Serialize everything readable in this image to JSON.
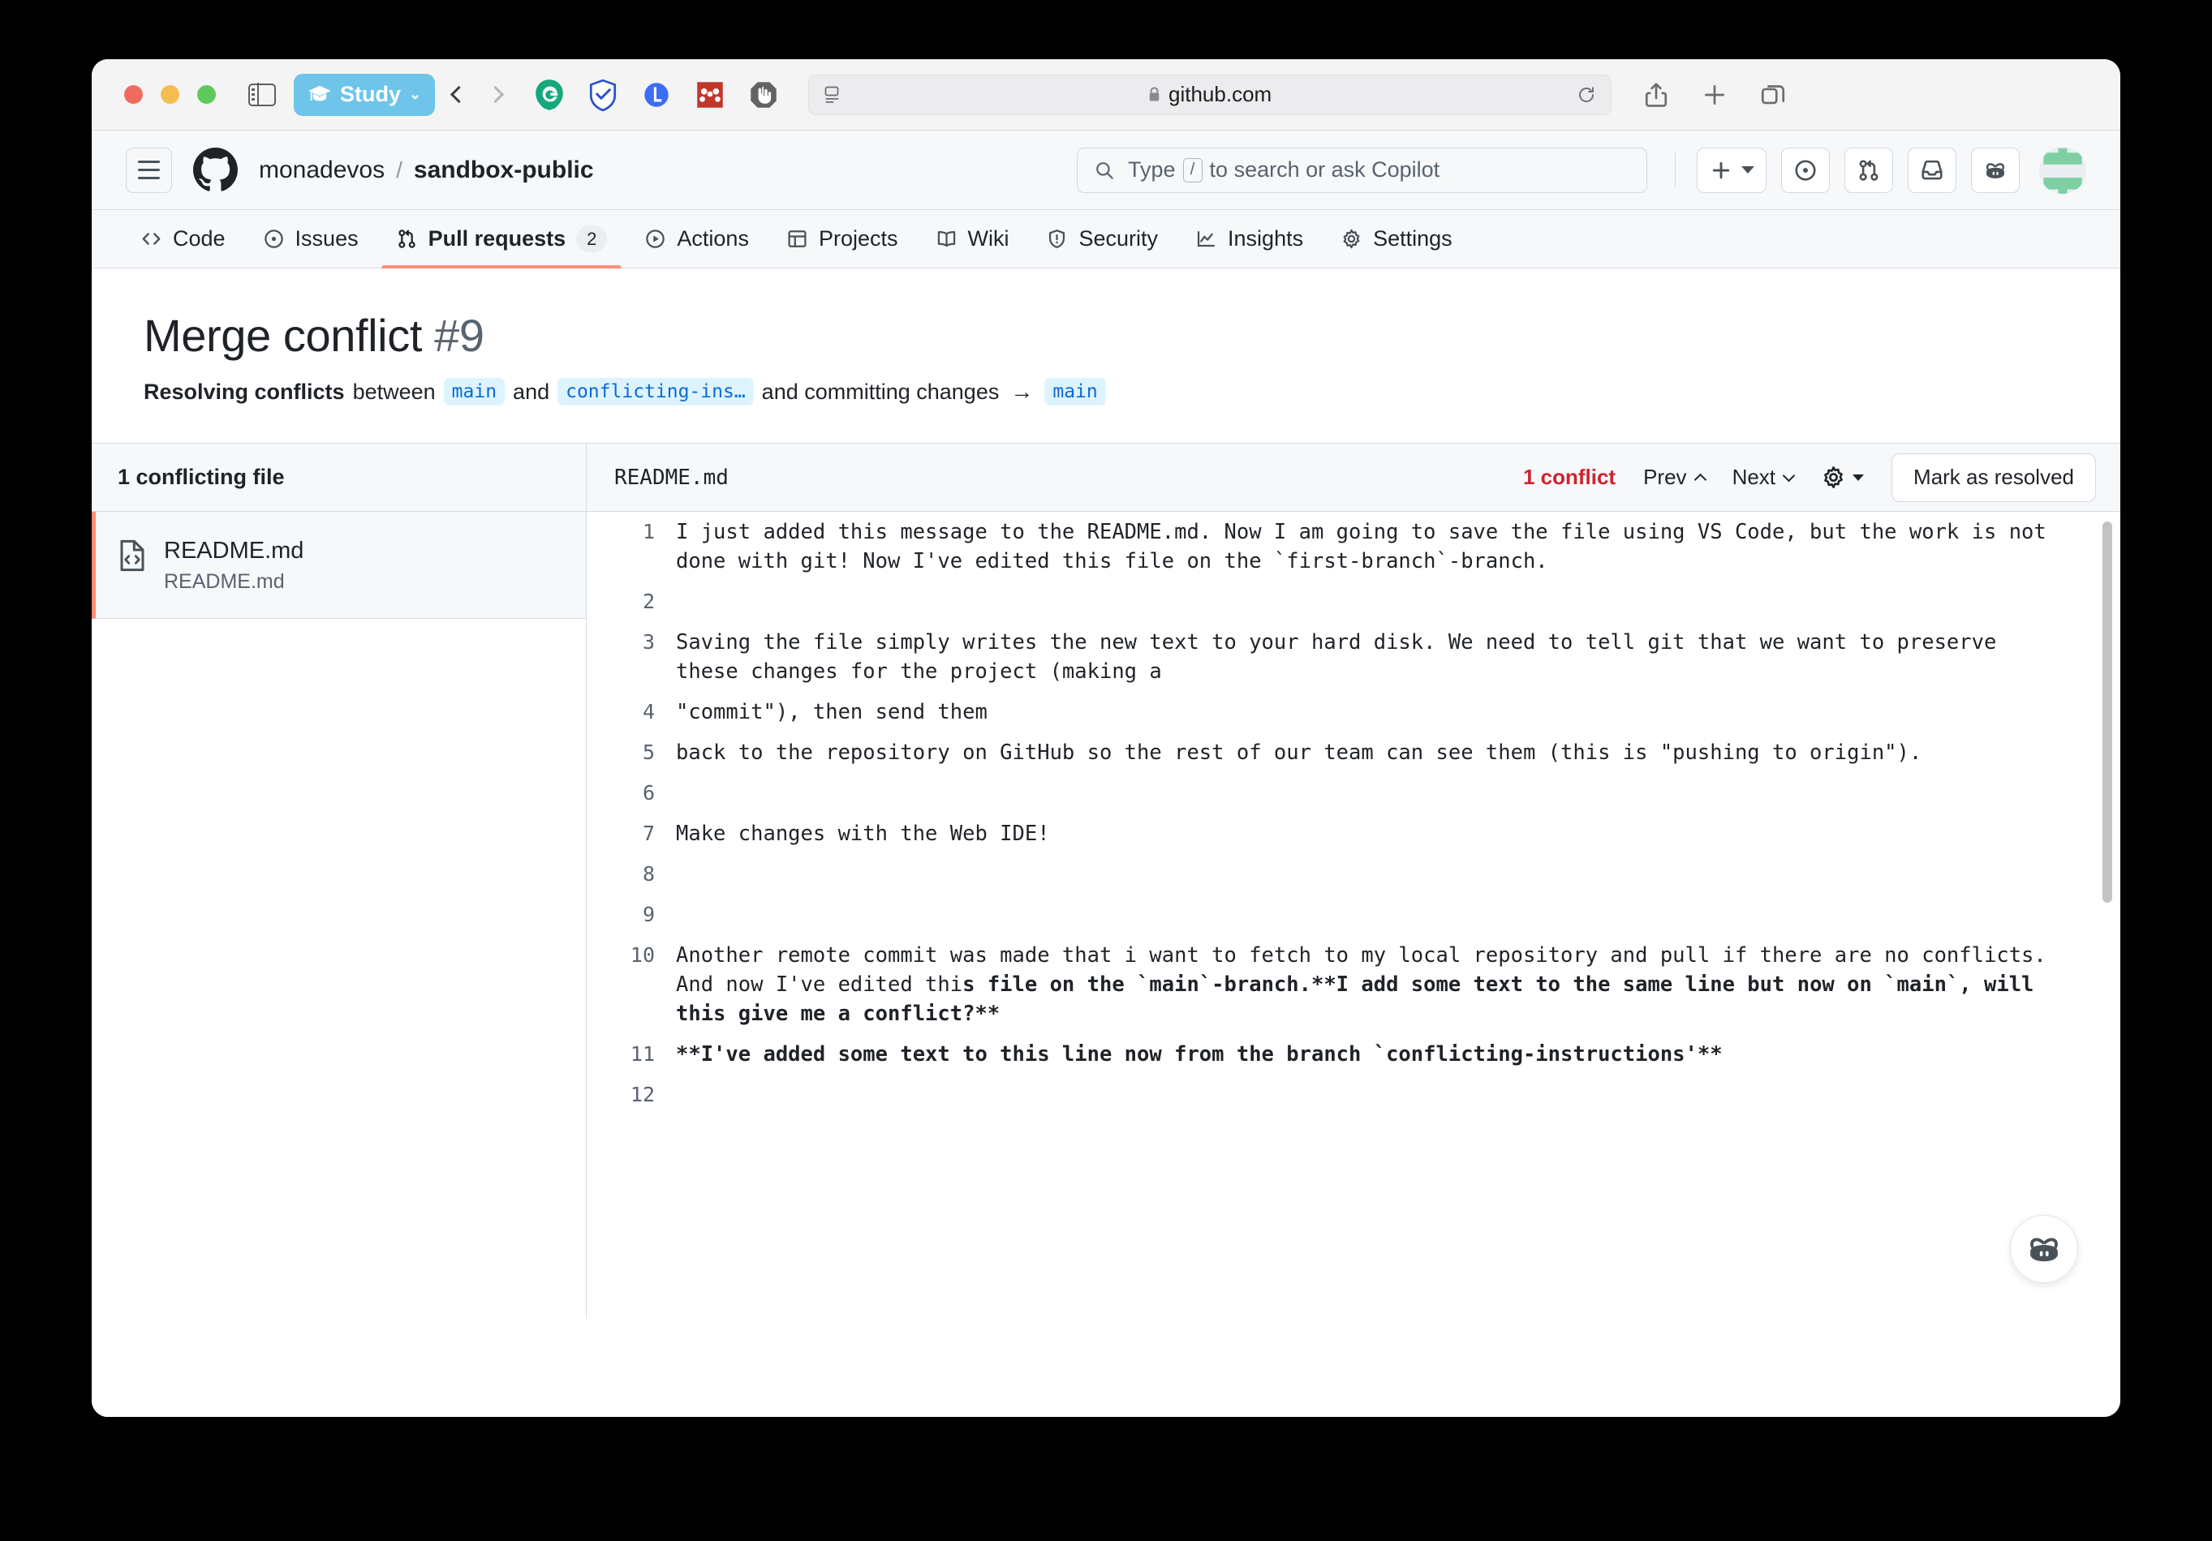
{
  "browser": {
    "profile_label": "Study",
    "address": "github.com",
    "extensions": [
      "grammarly-icon",
      "adguard-icon",
      "lastpass-icon",
      "mendeley-icon",
      "adblock-icon"
    ],
    "toolbar_icons": [
      "sidebar-toggle-icon",
      "back-icon",
      "forward-icon",
      "reader-icon",
      "lock-icon",
      "reload-icon",
      "share-icon",
      "new-tab-icon",
      "tab-overview-icon"
    ]
  },
  "header": {
    "owner": "monadevos",
    "separator": "/",
    "repo": "sandbox-public",
    "search_placeholder": "Type",
    "search_key": "/",
    "search_placeholder_tail": "to search or ask Copilot"
  },
  "tabs": [
    {
      "label": "Code",
      "icon": "code-icon",
      "badge": "",
      "active": false
    },
    {
      "label": "Issues",
      "icon": "issue-opened-icon",
      "badge": "",
      "active": false
    },
    {
      "label": "Pull requests",
      "icon": "git-pull-request-icon",
      "badge": "2",
      "active": true
    },
    {
      "label": "Actions",
      "icon": "play-icon",
      "badge": "",
      "active": false
    },
    {
      "label": "Projects",
      "icon": "table-icon",
      "badge": "",
      "active": false
    },
    {
      "label": "Wiki",
      "icon": "book-icon",
      "badge": "",
      "active": false
    },
    {
      "label": "Security",
      "icon": "shield-icon",
      "badge": "",
      "active": false
    },
    {
      "label": "Insights",
      "icon": "graph-icon",
      "badge": "",
      "active": false
    },
    {
      "label": "Settings",
      "icon": "gear-icon",
      "badge": "",
      "active": false
    }
  ],
  "page": {
    "title": "Merge conflict",
    "number": "#9",
    "subtitle_strong": "Resolving conflicts",
    "subtitle_between": "between",
    "branch_base": "main",
    "subtitle_and": "and",
    "branch_head": "conflicting-ins…",
    "subtitle_tail": "and committing changes",
    "arrow": "→",
    "branch_target": "main"
  },
  "file_pane": {
    "heading": "1 conflicting file",
    "files": [
      {
        "name": "README.md",
        "path": "README.md",
        "icon": "file-code-icon",
        "selected": true
      }
    ]
  },
  "editor": {
    "filename": "README.md",
    "conflict_count": "1 conflict",
    "prev_label": "Prev",
    "next_label": "Next",
    "settings_icon": "gear-icon",
    "resolve_label": "Mark as resolved",
    "lines": [
      {
        "n": "1",
        "text": "I just added this message to the README.md. Now I am going to save the file using VS Code, but the work is not done with git! Now I've edited this file on the `first-branch`-branch.",
        "bold_from": -1
      },
      {
        "n": "2",
        "text": "",
        "bold_from": -1
      },
      {
        "n": "3",
        "text": "Saving the file simply writes the new text to your hard disk. We need to tell git that we want to preserve these changes for the project (making a",
        "bold_from": -1
      },
      {
        "n": "4",
        "text": "\"commit\"), then send them",
        "bold_from": -1
      },
      {
        "n": "5",
        "text": "back to the repository on GitHub so the rest of our team can see them (this is \"pushing to origin\").",
        "bold_from": -1
      },
      {
        "n": "6",
        "text": "",
        "bold_from": -1
      },
      {
        "n": "7",
        "text": "Make changes with the Web IDE!",
        "bold_from": -1
      },
      {
        "n": "8",
        "text": "",
        "bold_from": -1
      },
      {
        "n": "9",
        "text": "",
        "bold_from": -1
      },
      {
        "n": "10",
        "text": "Another remote commit was made that i want to fetch to my local repository and pull if there are no conflicts. And now I've edited this file on the `main`-branch.**I add some text to the same line but now on `main`, will this give me a conflict?**",
        "bold_from": 134
      },
      {
        "n": "11",
        "text": "**I've added some text to this line now from the branch `conflicting-instructions'**",
        "bold_from": 0
      },
      {
        "n": "12",
        "text": "",
        "bold_from": -1
      }
    ]
  },
  "colors": {
    "accent_orange": "#fd8c73",
    "conflict_red": "#cf222e",
    "branch_chip_bg": "#ddf4ff",
    "branch_chip_fg": "#0969da",
    "profile_pill": "#6ec5e9"
  }
}
